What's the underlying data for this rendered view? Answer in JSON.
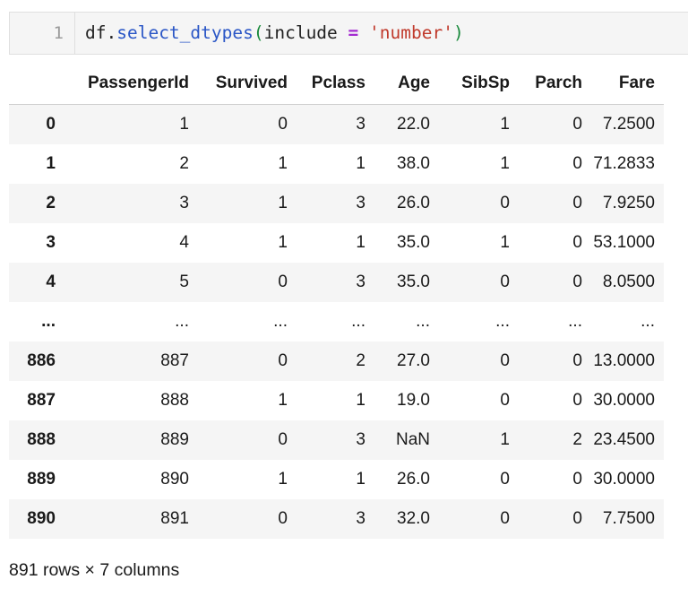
{
  "cell": {
    "line_number": "1",
    "code": {
      "obj": "df.",
      "method": "select_dtypes",
      "open_paren": "(",
      "arg_name": "include ",
      "op": "=",
      "space": " ",
      "arg_value": "'number'",
      "close_paren": ")"
    }
  },
  "table": {
    "columns": [
      "PassengerId",
      "Survived",
      "Pclass",
      "Age",
      "SibSp",
      "Parch",
      "Fare"
    ],
    "rows": [
      {
        "index": "0",
        "cells": [
          "1",
          "0",
          "3",
          "22.0",
          "1",
          "0",
          "7.2500"
        ]
      },
      {
        "index": "1",
        "cells": [
          "2",
          "1",
          "1",
          "38.0",
          "1",
          "0",
          "71.2833"
        ]
      },
      {
        "index": "2",
        "cells": [
          "3",
          "1",
          "3",
          "26.0",
          "0",
          "0",
          "7.9250"
        ]
      },
      {
        "index": "3",
        "cells": [
          "4",
          "1",
          "1",
          "35.0",
          "1",
          "0",
          "53.1000"
        ]
      },
      {
        "index": "4",
        "cells": [
          "5",
          "0",
          "3",
          "35.0",
          "0",
          "0",
          "8.0500"
        ]
      },
      {
        "index": "...",
        "cells": [
          "...",
          "...",
          "...",
          "...",
          "...",
          "...",
          "..."
        ]
      },
      {
        "index": "886",
        "cells": [
          "887",
          "0",
          "2",
          "27.0",
          "0",
          "0",
          "13.0000"
        ]
      },
      {
        "index": "887",
        "cells": [
          "888",
          "1",
          "1",
          "19.0",
          "0",
          "0",
          "30.0000"
        ]
      },
      {
        "index": "888",
        "cells": [
          "889",
          "0",
          "3",
          "NaN",
          "1",
          "2",
          "23.4500"
        ]
      },
      {
        "index": "889",
        "cells": [
          "890",
          "1",
          "1",
          "26.0",
          "0",
          "0",
          "30.0000"
        ]
      },
      {
        "index": "890",
        "cells": [
          "891",
          "0",
          "3",
          "32.0",
          "0",
          "0",
          "7.7500"
        ]
      }
    ]
  },
  "footer": "891 rows × 7 columns"
}
